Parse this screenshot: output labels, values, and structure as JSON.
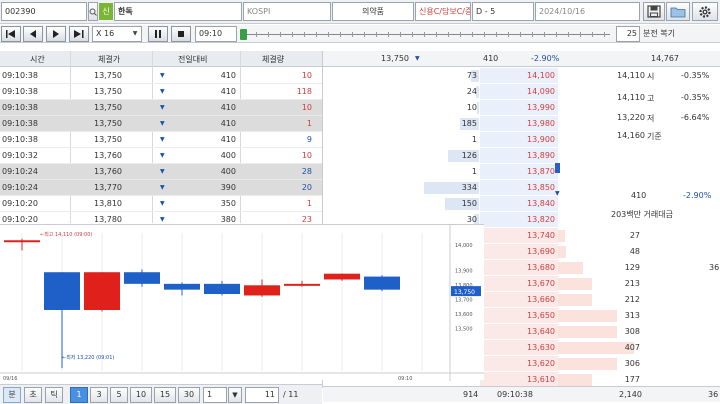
{
  "topbar": {
    "code": "002390",
    "tag": "신",
    "name": "한독",
    "market": "KOSPI",
    "sector": "의약품",
    "credit_info": "신용C/담보C/증40",
    "period": "D - 5",
    "date": "2024/10/16"
  },
  "controls": {
    "speed": "X 16",
    "time": "09:10",
    "replay_minutes": "25",
    "replay_label": "분전 복기"
  },
  "trades": {
    "headers": [
      "시간",
      "체결가",
      "전일대비",
      "체결량"
    ],
    "rows": [
      {
        "time": "09:10:38",
        "price": "13,750",
        "chg": "410",
        "vol": "10",
        "vol_color": "#d43c3c",
        "gray": false
      },
      {
        "time": "09:10:38",
        "price": "13,750",
        "chg": "410",
        "vol": "118",
        "vol_color": "#d43c3c",
        "gray": false
      },
      {
        "time": "09:10:38",
        "price": "13,750",
        "chg": "410",
        "vol": "10",
        "vol_color": "#d43c3c",
        "gray": true
      },
      {
        "time": "09:10:38",
        "price": "13,750",
        "chg": "410",
        "vol": "1",
        "vol_color": "#d43c3c",
        "gray": true
      },
      {
        "time": "09:10:38",
        "price": "13,750",
        "chg": "410",
        "vol": "9",
        "vol_color": "#1f4fa8",
        "gray": false
      },
      {
        "time": "09:10:32",
        "price": "13,760",
        "chg": "400",
        "vol": "10",
        "vol_color": "#d43c3c",
        "gray": false
      },
      {
        "time": "09:10:24",
        "price": "13,760",
        "chg": "400",
        "vol": "28",
        "vol_color": "#1f4fa8",
        "gray": true
      },
      {
        "time": "09:10:24",
        "price": "13,770",
        "chg": "390",
        "vol": "20",
        "vol_color": "#1f4fa8",
        "gray": true
      },
      {
        "time": "09:10:20",
        "price": "13,810",
        "chg": "350",
        "vol": "1",
        "vol_color": "#d43c3c",
        "gray": false
      },
      {
        "time": "09:10:20",
        "price": "13,780",
        "chg": "380",
        "vol": "23",
        "vol_color": "#d43c3c",
        "gray": false
      }
    ]
  },
  "orderbook": {
    "header_price": "13,750",
    "header_change": "410",
    "header_rate": "-2.90%",
    "header_right": "14,767",
    "asks": [
      {
        "qty": "73",
        "price": "14,100",
        "bar": 0.05
      },
      {
        "qty": "24",
        "price": "14,090",
        "bar": 0.02
      },
      {
        "qty": "10",
        "price": "13,990",
        "bar": 0.01
      },
      {
        "qty": "185",
        "price": "13,980",
        "bar": 0.12
      },
      {
        "qty": "1",
        "price": "13,900",
        "bar": 0.0
      },
      {
        "qty": "126",
        "price": "13,890",
        "bar": 0.2
      },
      {
        "qty": "1",
        "price": "13,870",
        "bar": 0.0
      },
      {
        "qty": "334",
        "price": "13,850",
        "bar": 0.35
      },
      {
        "qty": "150",
        "price": "13,840",
        "bar": 0.22
      },
      {
        "qty": "30",
        "price": "13,820",
        "bar": 0.03
      }
    ],
    "bids": [
      {
        "price": "13,740",
        "qty": "27",
        "bar": 0.08
      },
      {
        "price": "13,690",
        "qty": "48",
        "bar": 0.1
      },
      {
        "price": "13,680",
        "qty": "129",
        "bar": 0.3
      },
      {
        "price": "13,670",
        "qty": "213",
        "bar": 0.4
      },
      {
        "price": "13,660",
        "qty": "212",
        "bar": 0.4
      },
      {
        "price": "13,650",
        "qty": "313",
        "bar": 0.7
      },
      {
        "price": "13,640",
        "qty": "308",
        "bar": 0.7
      },
      {
        "price": "13,630",
        "qty": "407",
        "bar": 0.9
      },
      {
        "price": "13,620",
        "qty": "306",
        "bar": 0.7
      },
      {
        "price": "13,610",
        "qty": "177",
        "bar": 0.4
      }
    ],
    "bid_side_extra": "36",
    "info": {
      "high_price": "14,110",
      "high_label": "시",
      "high_rate": "-0.35%",
      "hi_price": "14,110",
      "hi_label": "고",
      "hi_rate": "-0.35%",
      "low_price": "13,220",
      "low_label": "저",
      "low_rate": "-6.64%",
      "base_price": "14,160",
      "base_label": "기준",
      "chg_value": "410",
      "chg_rate": "-2.90%",
      "volume_value": "203백만 거래대금"
    },
    "footer": {
      "total_ask": "914",
      "time": "09:10:38",
      "total_bid": "2,140",
      "extra": "36"
    }
  },
  "chart_data": {
    "type": "candlestick",
    "x_label": "09/16",
    "x_label_end": "09:10",
    "high_marker": "최고 14,110 (09:00)",
    "low_marker": "최저 13,220 (09:01)",
    "price_labels": [
      "13,900",
      "13,800",
      "13,700",
      "13,600",
      "13,500"
    ],
    "current_label": "13,750",
    "top_label": "14,000",
    "candles": [
      {
        "open": 14100,
        "close": 14100,
        "high": 14110,
        "low": 14030
      },
      {
        "open": 13880,
        "close": 13620,
        "high": 13880,
        "low": 13220
      },
      {
        "open": 13620,
        "close": 13880,
        "high": 13880,
        "low": 13610
      },
      {
        "open": 13880,
        "close": 13800,
        "high": 13900,
        "low": 13780
      },
      {
        "open": 13800,
        "close": 13760,
        "high": 13810,
        "low": 13720
      },
      {
        "open": 13800,
        "close": 13730,
        "high": 13820,
        "low": 13720
      },
      {
        "open": 13720,
        "close": 13790,
        "high": 13830,
        "low": 13710
      },
      {
        "open": 13790,
        "close": 13800,
        "high": 13820,
        "low": 13780
      },
      {
        "open": 13830,
        "close": 13870,
        "high": 13870,
        "low": 13820
      },
      {
        "open": 13850,
        "close": 13760,
        "high": 13860,
        "low": 13750
      }
    ]
  },
  "bottom": {
    "labels": [
      "분",
      "초",
      "틱",
      "1",
      "3",
      "5",
      "10",
      "15",
      "30"
    ],
    "count": "1",
    "page": "11",
    "page_total": "/ 11"
  }
}
